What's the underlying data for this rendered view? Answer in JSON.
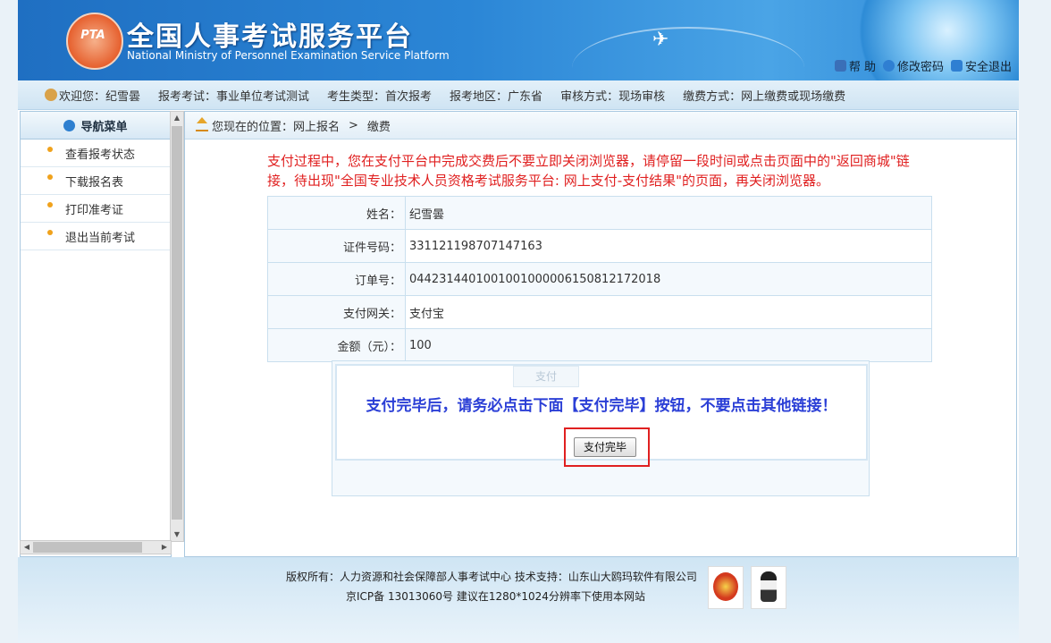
{
  "header": {
    "logo_text": "PTA",
    "title": "全国人事考试服务平台",
    "subtitle": "National Ministry of Personnel Examination Service Platform",
    "nav": [
      {
        "label": "帮 助",
        "icon": "lock-icon",
        "color": "#3a6fb8"
      },
      {
        "label": "修改密码",
        "icon": "question-icon",
        "color": "#2f7fd2"
      },
      {
        "label": "安全退出",
        "icon": "logout-icon",
        "color": "#2f7fd2"
      }
    ]
  },
  "infobar": {
    "welcome": "欢迎您：纪雪曇",
    "exam": "报考考试：事业单位考试测试",
    "type": "考生类型：首次报考",
    "region": "报考地区：广东省",
    "review": "审核方式：现场审核",
    "pay": "缴费方式：网上缴费或现场缴费"
  },
  "sidebar": {
    "title": "导航菜单",
    "items": [
      {
        "label": "查看报考状态"
      },
      {
        "label": "下载报名表"
      },
      {
        "label": "打印准考证"
      },
      {
        "label": "退出当前考试"
      }
    ]
  },
  "breadcrumb": {
    "text": "您现在的位置：网上报名",
    "sep": ">",
    "current": "缴费"
  },
  "notice": "支付过程中，您在支付平台中完成交费后不要立即关闭浏览器，请停留一段时间或点击页面中的\"返回商城\"链接，待出现\"全国专业技术人员资格考试服务平台: 网上支付-支付结果\"的页面，再关闭浏览器。",
  "order": [
    {
      "label": "姓名：",
      "value": "纪雪曇"
    },
    {
      "label": "证件号码：",
      "value": "331121198707147163"
    },
    {
      "label": "订单号：",
      "value": "04423144010010010000061508121720 18"
    },
    {
      "label": "支付网关：",
      "value": "支付宝"
    },
    {
      "label": "金额（元）：",
      "value": "100"
    }
  ],
  "pay": {
    "faded_button": "支付",
    "tip": "支付完毕后，请务必点击下面【支付完毕】按钮，不要点击其他链接！",
    "done_button": "支付完毕"
  },
  "footer": {
    "line1": "版权所有：人力资源和社会保障部人事考试中心   技术支持：山东山大鸥玛软件有限公司",
    "line2": "京ICP备 13013060号   建议在1280*1024分辨率下使用本网站"
  },
  "colors": {
    "notice": "#e02020",
    "tip": "#2b3fd6",
    "highlight_box": "#e02020"
  }
}
